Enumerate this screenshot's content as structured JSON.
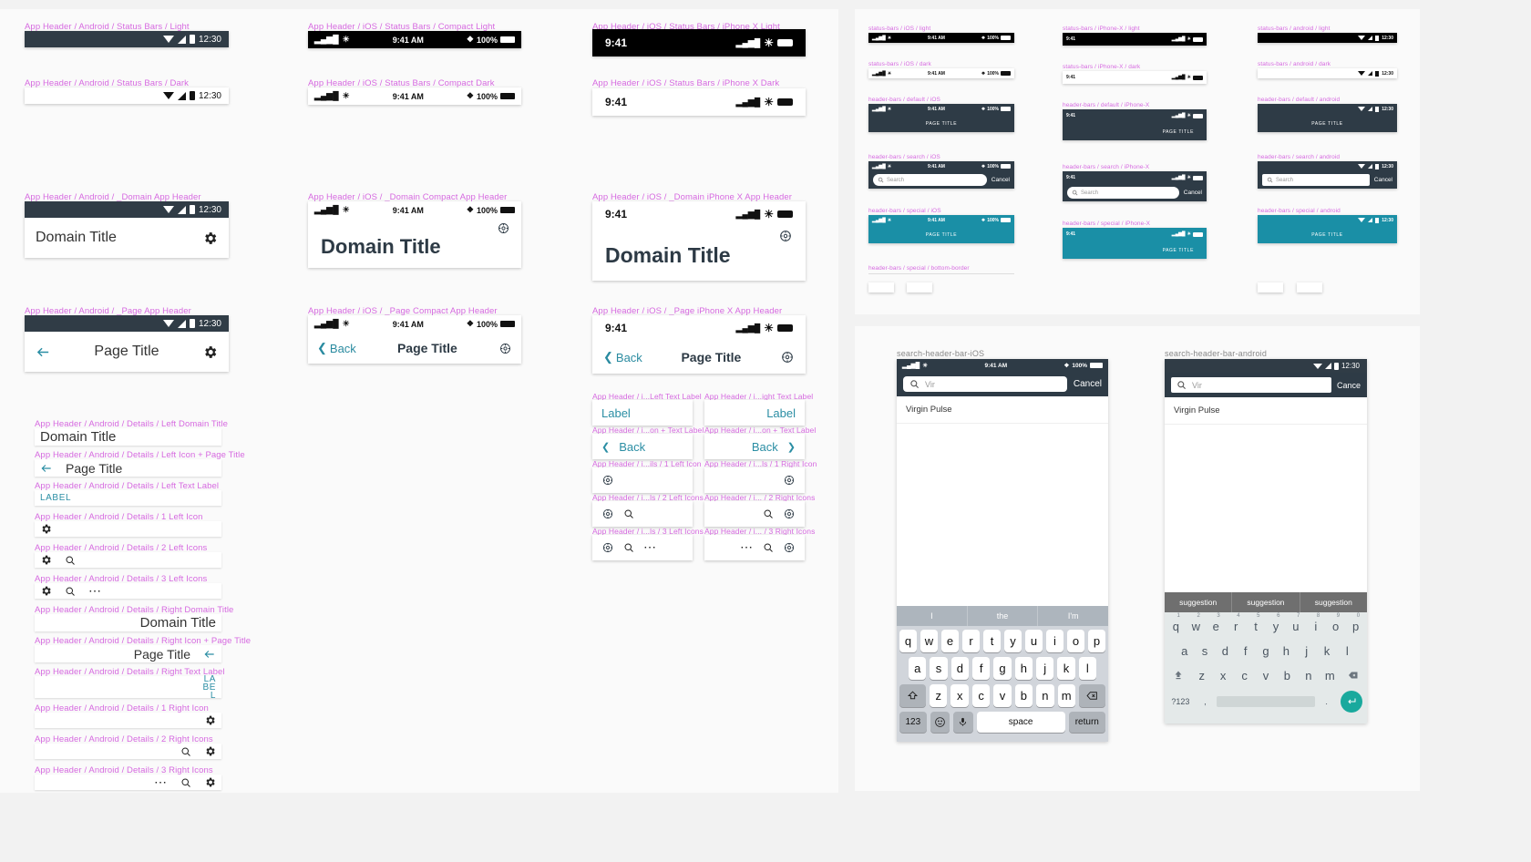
{
  "colors": {
    "label_magenta": "#d66ae0",
    "dark_navy": "#303c46",
    "teal": "#2b8ea4",
    "special_teal": "#1a8fa6",
    "android_enter": "#19a99d"
  },
  "common": {
    "android_time": "12:30",
    "ios_time": "9:41 AM",
    "iphonex_time": "9:41",
    "battery_pct": "100%",
    "page_title_caps": "PAGE TITLE",
    "search_placeholder": "Search",
    "cancel": "Cancel"
  },
  "left_panel": {
    "col1": {
      "status_light": {
        "label": "App Header / Android / Status Bars / Light",
        "time": "12:30"
      },
      "status_dark": {
        "label": "App Header / Android / Status Bars / Dark",
        "time": "12:30"
      },
      "domain_header": {
        "label": "App Header / Android / _Domain App Header",
        "time": "12:30",
        "title": "Domain Title"
      },
      "page_header": {
        "label": "App Header / Android / _Page App Header",
        "time": "12:30",
        "title": "Page Title"
      },
      "details": [
        {
          "label": "App Header / Android / Details / Left Domain Title",
          "text": "Domain Title",
          "kind": "title-left"
        },
        {
          "label": "App Header / Android / Details / Left Icon  + Page Title",
          "text": "Page Title",
          "kind": "back-title"
        },
        {
          "label": "App Header / Android / Details / Left Text Label",
          "text": "LABEL",
          "kind": "label-left"
        },
        {
          "label": "App Header / Android / Details / 1 Left Icon",
          "text": "",
          "kind": "icons-left-1"
        },
        {
          "label": "App Header / Android / Details / 2 Left Icons",
          "text": "",
          "kind": "icons-left-2"
        },
        {
          "label": "App Header / Android / Details / 3 Left Icons",
          "text": "",
          "kind": "icons-left-3"
        },
        {
          "label": "App Header / Android / Details / Right Domain Title",
          "text": "Domain Title",
          "kind": "title-right"
        },
        {
          "label": "App Header / Android / Details / Right Icon  + Page Title",
          "text": "Page Title",
          "kind": "title-back-right"
        },
        {
          "label": "App Header / Android / Details / Right Text Label",
          "text": "LABEL",
          "kind": "label-right"
        },
        {
          "label": "App Header / Android / Details / 1 Right Icon",
          "text": "",
          "kind": "icons-right-1"
        },
        {
          "label": "App Header / Android / Details / 2 Right Icons",
          "text": "",
          "kind": "icons-right-2"
        },
        {
          "label": "App Header / Android / Details / 3 Right Icons",
          "text": "",
          "kind": "icons-right-3"
        }
      ]
    },
    "col2": {
      "status_light": {
        "label": "App Header / iOS / Status Bars / Compact Light",
        "time": "9:41 AM",
        "battery": "100%"
      },
      "status_dark": {
        "label": "App Header / iOS / Status Bars / Compact Dark",
        "time": "9:41 AM",
        "battery": "100%"
      },
      "domain_header": {
        "label": "App Header / iOS / _Domain Compact App Header",
        "time": "9:41 AM",
        "battery": "100%",
        "title": "Domain Title"
      },
      "page_header": {
        "label": "App Header / iOS / _Page Compact App Header",
        "time": "9:41 AM",
        "battery": "100%",
        "back": "Back",
        "title": "Page Title"
      }
    },
    "col3": {
      "status_light": {
        "label": "App Header / iOS / Status Bars / iPhone X Light",
        "time": "9:41"
      },
      "status_dark": {
        "label": "App Header / iOS / Status Bars / iPhone X Dark",
        "time": "9:41"
      },
      "domain_header": {
        "label": "App Header / iOS / _Domain iPhone X App Header",
        "time": "9:41",
        "title": "Domain Title"
      },
      "page_header": {
        "label": "App Header / iOS / _Page iPhone X App Header",
        "time": "9:41",
        "back": "Back",
        "title": "Page Title"
      },
      "details_left": [
        {
          "label": "App Header / i...Left Text Label",
          "text": "Label",
          "kind": "label"
        },
        {
          "label": "App Header / i...on + Text Label",
          "text": "Back",
          "kind": "back"
        },
        {
          "label": "App Header / i...ils / 1 Left Icon",
          "text": "",
          "kind": "i1"
        },
        {
          "label": "App Header / i...ls / 2 Left Icons",
          "text": "",
          "kind": "i2"
        },
        {
          "label": "App Header / i...ls / 3 Left Icons",
          "text": "",
          "kind": "i3"
        }
      ],
      "details_right": [
        {
          "label": "App Header / i...ight Text Label",
          "text": "Label",
          "kind": "label"
        },
        {
          "label": "App Header / i...on + Text Label",
          "text": "Back",
          "kind": "back"
        },
        {
          "label": "App Header / i...ls / 1 Right Icon",
          "text": "",
          "kind": "i1"
        },
        {
          "label": "App Header / i... / 2 Right Icons",
          "text": "",
          "kind": "i2"
        },
        {
          "label": "App Header / i... / 3 Right Icons",
          "text": "",
          "kind": "i3"
        }
      ]
    }
  },
  "right_top_panel": {
    "columns": [
      {
        "items": [
          {
            "label": "status-bars / iOS / light",
            "type": "sb-ios",
            "theme": "black",
            "time": "9:41 AM",
            "battery": "100%"
          },
          {
            "label": "status-bars / iOS / dark",
            "type": "sb-ios",
            "theme": "white",
            "time": "9:41 AM",
            "battery": "100%"
          },
          {
            "label": "header-bars / default / iOS",
            "type": "hb-default",
            "theme": "navy",
            "time": "9:41 AM",
            "battery": "100%",
            "title": "PAGE TITLE"
          },
          {
            "label": "header-bars / search / iOS",
            "type": "hb-search",
            "theme": "navy",
            "time": "9:41 AM",
            "battery": "100%",
            "placeholder": "Search",
            "cancel": "Cancel"
          },
          {
            "label": "header-bars / special / iOS",
            "type": "hb-default",
            "theme": "teal",
            "time": "9:41 AM",
            "battery": "100%",
            "title": "PAGE TITLE"
          },
          {
            "label": "header-bars / special / bottom-border",
            "type": "divider"
          }
        ]
      },
      {
        "items": [
          {
            "label": "status-bars / iPhone-X / light",
            "type": "sb-ipx",
            "theme": "black",
            "time": "9:41"
          },
          {
            "label": "status-bars / iPhone-X / dark",
            "type": "sb-ipx",
            "theme": "white",
            "time": "9:41"
          },
          {
            "label": "header-bars / default / iPhone-X",
            "type": "hbx-default",
            "theme": "navy",
            "time": "9:41",
            "title": "PAGE TITLE"
          },
          {
            "label": "header-bars / search / iPhone-X",
            "type": "hbx-search",
            "theme": "navy",
            "time": "9:41",
            "placeholder": "Search",
            "cancel": "Cancel"
          },
          {
            "label": "header-bars / special / iPhone-X",
            "type": "hbx-default",
            "theme": "teal",
            "time": "9:41",
            "title": "PAGE TITLE"
          }
        ]
      },
      {
        "items": [
          {
            "label": "status-bars / android / light",
            "type": "sb-and",
            "theme": "black",
            "time": "12:30"
          },
          {
            "label": "status-bars / android / dark",
            "type": "sb-and",
            "theme": "white",
            "time": "12:30"
          },
          {
            "label": "header-bars / default / android",
            "type": "hba-default",
            "theme": "navy",
            "time": "12:30",
            "title": "PAGE TITLE"
          },
          {
            "label": "header-bars / search / android",
            "type": "hba-search",
            "theme": "navy",
            "time": "12:30",
            "placeholder": "Search",
            "cancel": "Cancel"
          },
          {
            "label": "header-bars / special / android",
            "type": "hba-default",
            "theme": "teal",
            "time": "12:30",
            "title": "PAGE TITLE"
          }
        ]
      }
    ]
  },
  "right_bottom_panel": {
    "ios": {
      "label": "search-header-bar-iOS",
      "time": "9:41 AM",
      "battery": "100%",
      "query": "Vir",
      "cancel": "Cancel",
      "result": "Virgin Pulse",
      "predictions": [
        "I",
        "the",
        "I'm"
      ],
      "rows": [
        [
          "q",
          "w",
          "e",
          "r",
          "t",
          "y",
          "u",
          "i",
          "o",
          "p"
        ],
        [
          "a",
          "s",
          "d",
          "f",
          "g",
          "h",
          "j",
          "k",
          "l"
        ],
        [
          "z",
          "x",
          "c",
          "v",
          "b",
          "n",
          "m"
        ]
      ],
      "shift_key": "shift-icon",
      "backspace_key": "backspace-icon",
      "numbers_key": "123",
      "emoji_key": "emoji-icon",
      "mic_key": "mic-icon",
      "space_key": "space",
      "return_key": "return"
    },
    "android": {
      "label": "search-header-bar-android",
      "time": "12:30",
      "query": "Vir",
      "cancel": "Cance",
      "result": "Virgin Pulse",
      "suggestions": [
        "suggestion",
        "suggestion",
        "suggestion"
      ],
      "rows": [
        [
          "q",
          "w",
          "e",
          "r",
          "t",
          "y",
          "u",
          "i",
          "o",
          "p"
        ],
        [
          "a",
          "s",
          "d",
          "f",
          "g",
          "h",
          "j",
          "k",
          "l"
        ],
        [
          "z",
          "x",
          "c",
          "v",
          "b",
          "n",
          "m"
        ]
      ],
      "row1_numbers": [
        "1",
        "2",
        "3",
        "4",
        "5",
        "6",
        "7",
        "8",
        "9",
        "0"
      ],
      "shift_key": "shift-icon",
      "backspace_key": "backspace-icon",
      "symbols_key": "?123",
      "comma_key": ",",
      "period_key": ".",
      "enter_key": "enter-icon"
    }
  }
}
